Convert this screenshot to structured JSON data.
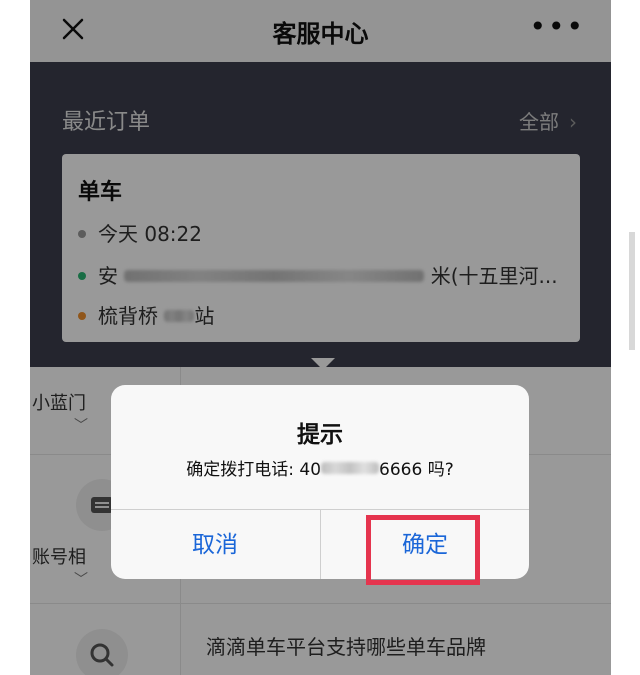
{
  "nav": {
    "title": "客服中心",
    "close_icon": "close-icon",
    "more_label": "•••"
  },
  "orders": {
    "heading": "最近订单",
    "all_label": "全部",
    "all_chevron": "›",
    "card": {
      "type": "单车",
      "time": "今天 08:22",
      "start_prefix": "安",
      "start_suffix": "米(十五里河...",
      "end_prefix": "梳背桥",
      "end_suffix": "站"
    },
    "colors": {
      "time_dot": "#999999",
      "start_dot": "#2bb673",
      "end_dot": "#f0902e"
    }
  },
  "lower": {
    "side_item_1": "小蓝门",
    "side_item_2": "账号相",
    "faq_1": "滴滴单车平台支持哪些单车品牌"
  },
  "dialog": {
    "title": "提示",
    "message_prefix": "确定拨打电话: 40",
    "message_suffix": "6666 吗?",
    "cancel_label": "取消",
    "confirm_label": "确定"
  },
  "accent": {
    "button_blue": "#1a66d8",
    "highlight_red": "#e5344e"
  }
}
